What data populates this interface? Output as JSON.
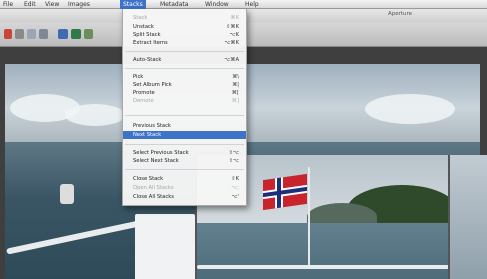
{
  "menubar": {
    "items": [
      "File",
      "Edit",
      "View",
      "Images",
      "Stacks",
      "Metadata",
      "Window",
      "Help"
    ],
    "active_index": 4
  },
  "window": {
    "title": "Aperture"
  },
  "stacks_menu": {
    "items": [
      {
        "label": "Stack",
        "shortcut": "⌘K",
        "enabled": false
      },
      {
        "label": "Unstack",
        "shortcut": "⇧⌘K",
        "enabled": true
      },
      {
        "label": "Split Stack",
        "shortcut": "⌥K",
        "enabled": true
      },
      {
        "label": "Extract Items",
        "shortcut": "⌥⌘K",
        "enabled": true
      },
      {
        "label": "Auto-Stack",
        "shortcut": "⌥⌘A",
        "enabled": true
      },
      {
        "label": "Pick",
        "shortcut": "⌘\\",
        "enabled": true
      },
      {
        "label": "Set Album Pick",
        "shortcut": "⌘|",
        "enabled": true
      },
      {
        "label": "Promote",
        "shortcut": "⌘[",
        "enabled": true
      },
      {
        "label": "Demote",
        "shortcut": "⌘]",
        "enabled": false
      },
      {
        "label": "Previous Stack",
        "shortcut": "",
        "enabled": true
      },
      {
        "label": "Next Stack",
        "shortcut": "",
        "enabled": true,
        "highlighted": true
      },
      {
        "label": "Select Previous Stack",
        "shortcut": "⇧⌥",
        "enabled": true
      },
      {
        "label": "Select Next Stack",
        "shortcut": "⇧⌥",
        "enabled": true
      },
      {
        "label": "Close Stack",
        "shortcut": "⇧K",
        "enabled": true
      },
      {
        "label": "Open All Stacks",
        "shortcut": "⌥;",
        "enabled": false
      },
      {
        "label": "Close All Stacks",
        "shortcut": "⌥'",
        "enabled": true
      }
    ]
  },
  "colors": {
    "highlight": "#3d73c9",
    "menu_bg": "#f6f6f6",
    "flag_red": "#c8242d",
    "flag_blue": "#1d2f7a"
  }
}
